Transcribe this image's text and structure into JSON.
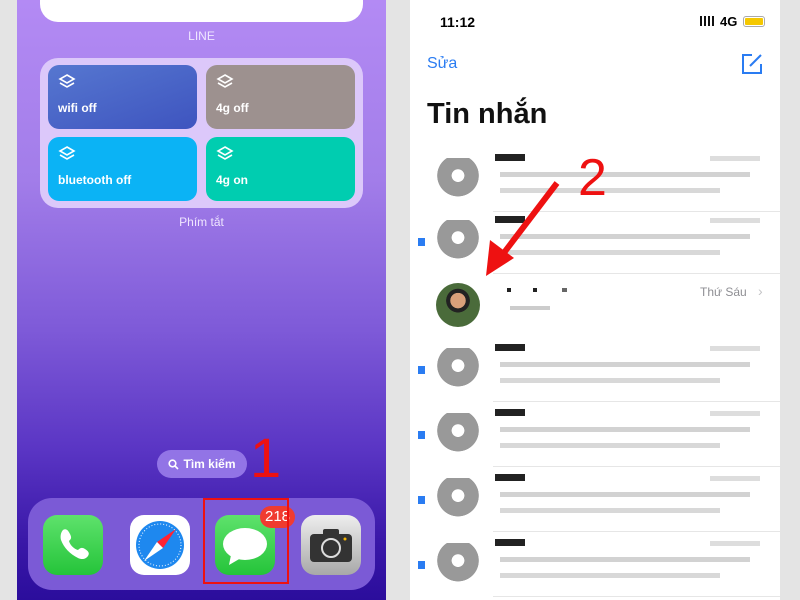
{
  "home": {
    "line_label": "LINE",
    "shortcuts_label": "Phím tắt",
    "tiles": [
      {
        "label": "wifi off",
        "color": "#4a64c8"
      },
      {
        "label": "4g off",
        "color": "#9d918f"
      },
      {
        "label": "bluetooth off",
        "color": "#0bb3f5"
      },
      {
        "label": "4g on",
        "color": "#00cdb0"
      }
    ],
    "search_label": "Tìm kiếm",
    "dock": [
      "phone",
      "safari",
      "messages",
      "camera"
    ],
    "messages_badge": "218",
    "step_marker": "1"
  },
  "messages": {
    "time": "11:12",
    "network": "4G",
    "edit_label": "Sửa",
    "title": "Tin nhắn",
    "highlight_date": "Thứ Sáu",
    "step_marker": "2"
  },
  "colors": {
    "annotation": "#ee1111",
    "accent": "#2a7cf2",
    "badge": "#f03b30"
  }
}
